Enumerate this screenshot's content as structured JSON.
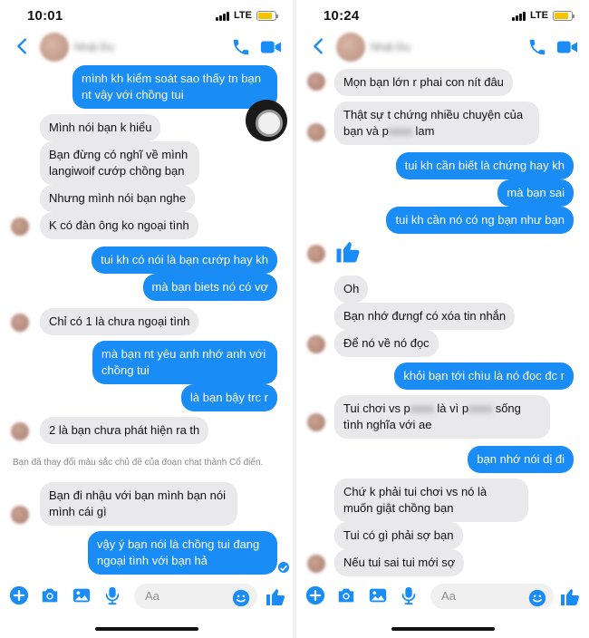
{
  "colors": {
    "accent": "#1a8cf5",
    "incoming_bubble": "#e9e9eb",
    "outgoing_text": "#ffffff"
  },
  "left": {
    "status": {
      "time": "10:01",
      "network": "LTE"
    },
    "header": {
      "contact_name": "Nhật Đu"
    },
    "messages": [
      {
        "side": "out",
        "text": "mình kh kiểm soát sao thấy tn bạn nt vậy với chồng tui"
      },
      {
        "side": "in",
        "text": "Mình nói bạn k hiểu"
      },
      {
        "side": "in",
        "text": "Bạn đừng có nghĩ về mình langiwoif cướp chồng bạn"
      },
      {
        "side": "in",
        "text": "Nhưng mình nói bạn nghe"
      },
      {
        "side": "in",
        "text": "K có đàn ông ko ngoại tình"
      },
      {
        "side": "out",
        "text": "tui kh có nói là bạn cướp hay kh"
      },
      {
        "side": "out",
        "text": "mà bạn biets nó có vợ"
      },
      {
        "side": "in",
        "text": "Chỉ có 1 là chưa ngoại tình"
      },
      {
        "side": "out",
        "text": "mà bạn nt yêu anh nhớ anh với chồng tui"
      },
      {
        "side": "out",
        "text": "là bạn bậy trc r"
      },
      {
        "side": "in",
        "text": "2 là bạn chưa phát hiện ra th"
      },
      {
        "side": "in",
        "text": "Bạn đi nhậu với bạn mình bạn nói mình cái gì"
      },
      {
        "side": "out",
        "text": "vậy ý bạn nói là chồng tui đang ngoại tình với bạn hả"
      }
    ],
    "system_message": "Bạn đã thay đổi màu sắc chủ đề của đoạn chat thành Cổ điển.",
    "composer": {
      "placeholder": "Aa"
    }
  },
  "right": {
    "status": {
      "time": "10:24",
      "network": "LTE"
    },
    "header": {
      "contact_name": "Nhật Đu"
    },
    "messages": [
      {
        "side": "in",
        "text": "Mọn bạn lớn r phai con nít đâu"
      },
      {
        "side": "in",
        "text_a": "Thật sự t chứng nhiều chuyện của bạn và p",
        "text_hidden": "xxxx",
        "text_b": " lam"
      },
      {
        "side": "out",
        "text": "tui kh cần biết là chứng hay kh"
      },
      {
        "side": "out",
        "text": "mà bạn sai"
      },
      {
        "side": "out",
        "text": "tui kh cần nó có ng bạn như bạn"
      },
      {
        "side": "in",
        "icon": "thumbs-up"
      },
      {
        "side": "in",
        "text": "Oh"
      },
      {
        "side": "in",
        "text": "Bạn nhớ đưngf có xóa tin nhắn"
      },
      {
        "side": "in",
        "text": "Để nó về nó đọc"
      },
      {
        "side": "out",
        "text": "khỏi bạn tới chìu là nó đọc đc r"
      },
      {
        "side": "in",
        "text_a": "Tui chơi vs p",
        "text_hidden1": "xxxx",
        "text_b": " là vì p",
        "text_hidden2": "xxxx",
        "text_c": " sống tình nghĩa với ae"
      },
      {
        "side": "out",
        "text": "bạn nhớ nói dị đi"
      },
      {
        "side": "in",
        "text": "Chứ k phải tui chơi vs nó là muốn giật chồng bạn"
      },
      {
        "side": "in",
        "text": "Tui có gì phải sợ bạn"
      },
      {
        "side": "in",
        "text": "Nếu tui sai tui mới sợ"
      }
    ],
    "composer": {
      "placeholder": "Aa"
    }
  }
}
